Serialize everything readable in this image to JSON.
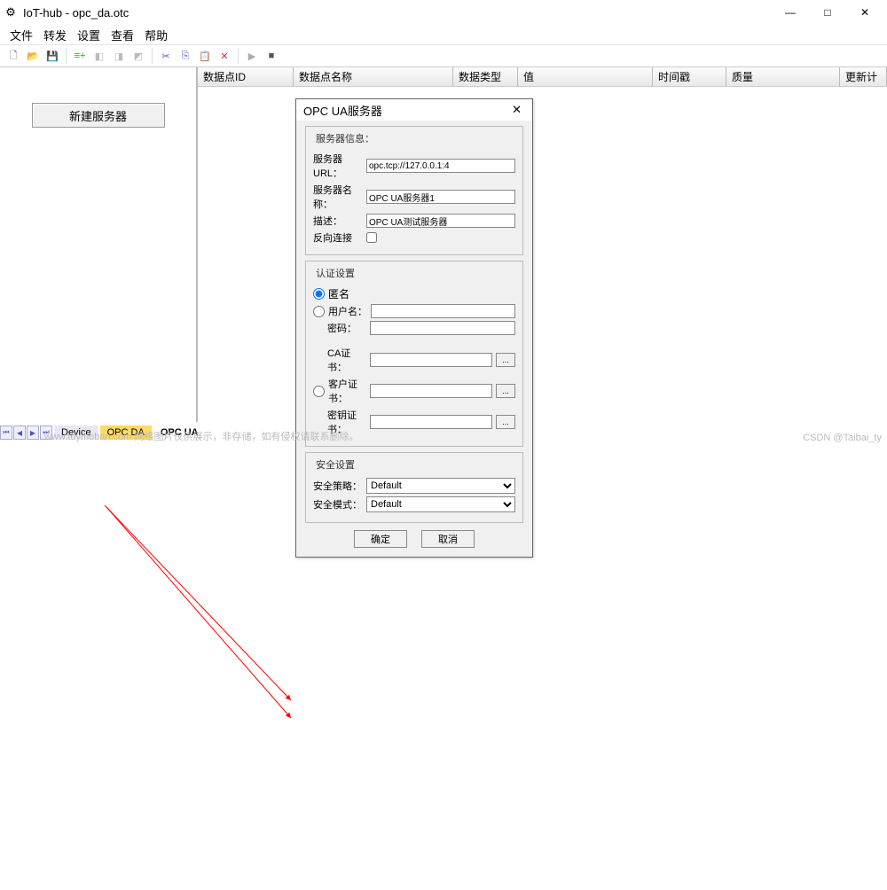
{
  "window": {
    "title": "IoT-hub - opc_da.otc",
    "minimize": "—",
    "maximize": "□",
    "close": "✕"
  },
  "menu": {
    "file": "文件",
    "forward": "转发",
    "settings": "设置",
    "view": "查看",
    "help": "帮助"
  },
  "sidebar": {
    "new_server": "新建服务器"
  },
  "grid": {
    "cols": [
      "数据点ID",
      "数据点名称",
      "数据类型",
      "值",
      "时间戳",
      "质量",
      "更新计"
    ]
  },
  "tabs": {
    "device": "Device",
    "opcda": "OPC DA",
    "opcua": "OPC UA"
  },
  "dialog": {
    "title": "OPC UA服务器",
    "server_info_legend": "服务器信息：",
    "url_label": "服务器URL：",
    "url_value": "opc.tcp://127.0.0.1:4",
    "name_label": "服务器名称：",
    "name_value": "OPC UA服务器1",
    "desc_label": "描述：",
    "desc_value": "OPC UA测试服务器",
    "reverse_label": "反向连接",
    "auth_legend": "认证设置",
    "anon_label": "匿名",
    "user_label": "用户名：",
    "user_value": "",
    "pass_label": "密码：",
    "pass_value": "",
    "ca_label": "CA证书：",
    "ca_value": "",
    "client_cert_label": "客户证书：",
    "client_cert_value": "",
    "key_label": "密钥证书：",
    "key_value": "",
    "browse": "...",
    "security_legend": "安全设置",
    "policy_label": "安全策略：",
    "policy_value": "Default",
    "mode_label": "安全模式：",
    "mode_value": "Default",
    "ok": "确定",
    "cancel": "取消"
  },
  "watermark": "www.toymoban.com 网络图片仅供展示，非存储，如有侵权请联系删除。",
  "credit": "CSDN @Taibai_ty"
}
